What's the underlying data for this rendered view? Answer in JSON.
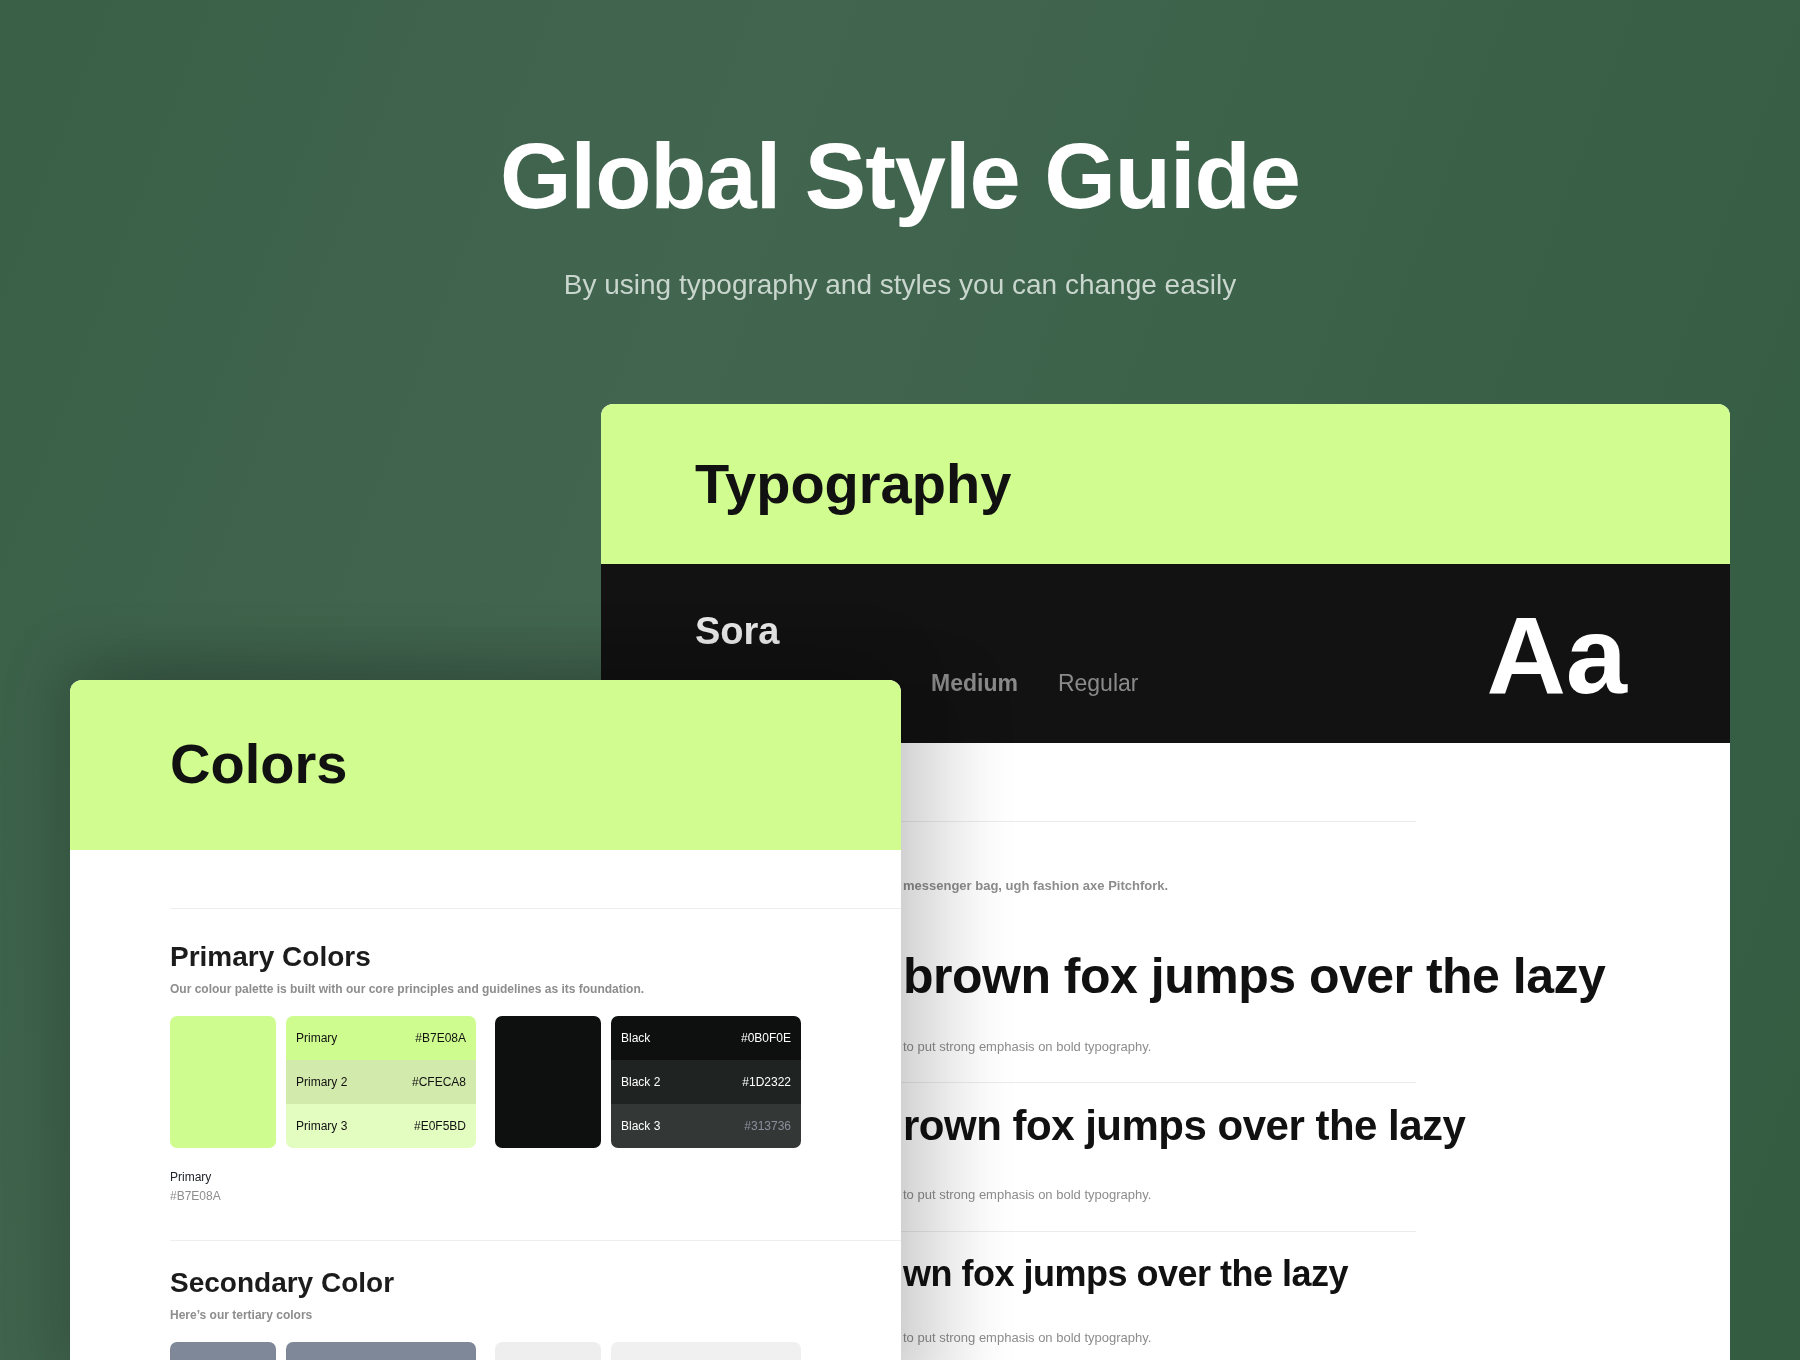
{
  "header": {
    "title": "Global Style Guide",
    "subtitle": "By using typography and styles you can change easily"
  },
  "typography_card": {
    "title": "Typography",
    "font_name": "Sora",
    "weights": [
      {
        "label": "Medium"
      },
      {
        "label": "Regular"
      }
    ],
    "sample_glyphs": "Aa",
    "intro_caption": "messenger bag, ugh fashion axe Pitchfork.",
    "samples": [
      {
        "text": "brown fox jumps over the lazy",
        "caption": "to put strong emphasis on bold typography."
      },
      {
        "text": "rown fox jumps over the lazy",
        "caption": "to put strong emphasis on bold typography."
      },
      {
        "text": "wn fox jumps over the lazy",
        "caption": "to put strong emphasis on bold typography."
      }
    ]
  },
  "colors_card": {
    "title": "Colors",
    "sections": [
      {
        "title": "Primary Colors",
        "description": "Our colour palette is built with our core principles and guidelines as its foundation.",
        "palettes": [
          {
            "color": "#cffc8f",
            "caption_name": "Primary",
            "caption_hex": "#B7E08A",
            "shades": [
              {
                "name": "Primary",
                "hex": "#B7E08A",
                "color": "#cffc8f"
              },
              {
                "name": "Primary 2",
                "hex": "#CFECA8",
                "color": "#d3eaad"
              },
              {
                "name": "Primary 3",
                "hex": "#E0F5BD",
                "color": "#e3fcc0"
              }
            ]
          },
          {
            "color": "#0e100f",
            "shades": [
              {
                "name": "Black",
                "hex": "#0B0F0E",
                "color": "#0e100f"
              },
              {
                "name": "Black 2",
                "hex": "#1D2322",
                "color": "#1f2322"
              },
              {
                "name": "Black 3",
                "hex": "#313736",
                "color": "#333837"
              }
            ]
          }
        ]
      },
      {
        "title": "Secondary Color",
        "description": "Here’s our tertiary colors",
        "palettes": [
          {
            "color": "#7e8899",
            "shades": [
              {
                "color": "#7e8899"
              }
            ]
          },
          {
            "color": "#eeeeee",
            "shades": [
              {
                "color": "#f0f0f0"
              }
            ]
          }
        ]
      }
    ]
  }
}
